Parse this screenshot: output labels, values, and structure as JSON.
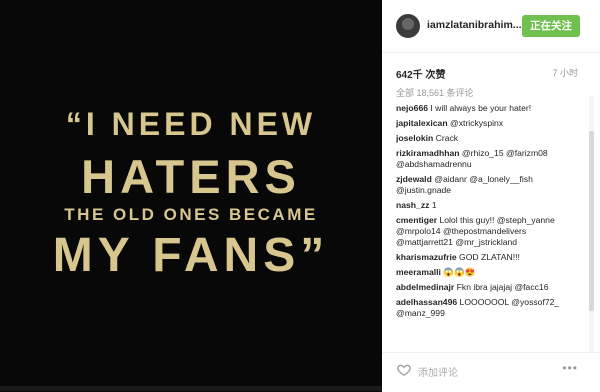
{
  "photo": {
    "lines": [
      "“I NEED NEW",
      "HATERS",
      "THE OLD ONES BECAME",
      "MY FANS”"
    ]
  },
  "header": {
    "username": "iamzlatanibrahim...",
    "follow_label": "正在关注"
  },
  "post": {
    "likes": "642千 次赞",
    "time": "7 小时",
    "view_all": "全部 18,561 条评论"
  },
  "comments": [
    {
      "user": "nejo666",
      "text": " I will always be your hater!"
    },
    {
      "user": "japitalexican",
      "text": " @xtrickyspinx"
    },
    {
      "user": "joselokin",
      "text": " Crack"
    },
    {
      "user": "rizkiramadhhan",
      "text": " @rhizo_15 @farizm08 @abdshamadrennu"
    },
    {
      "user": "zjdewald",
      "text": " @aidanr @a_lonely__fish @justin.gnade"
    },
    {
      "user": "nash_zz",
      "text": " 1"
    },
    {
      "user": "cmentiger",
      "text": " Lolol this guy!! @steph_yanne @mrpolo14 @thepostmandelivers @mattjarrett21 @mr_jstrickland"
    },
    {
      "user": "kharismazufrie",
      "text": " GOD ZLATAN!!!"
    },
    {
      "user": "meeramalli",
      "text": " 😱😱😍"
    },
    {
      "user": "abdelmedinajr",
      "text": " Fkn ibra jajajaj @facc16"
    },
    {
      "user": "adelhassan496",
      "text": " LOOOOOOL @yossof72_ @manz_999"
    }
  ],
  "footer": {
    "add_comment_placeholder": "添加评论",
    "more_label": "•••"
  }
}
